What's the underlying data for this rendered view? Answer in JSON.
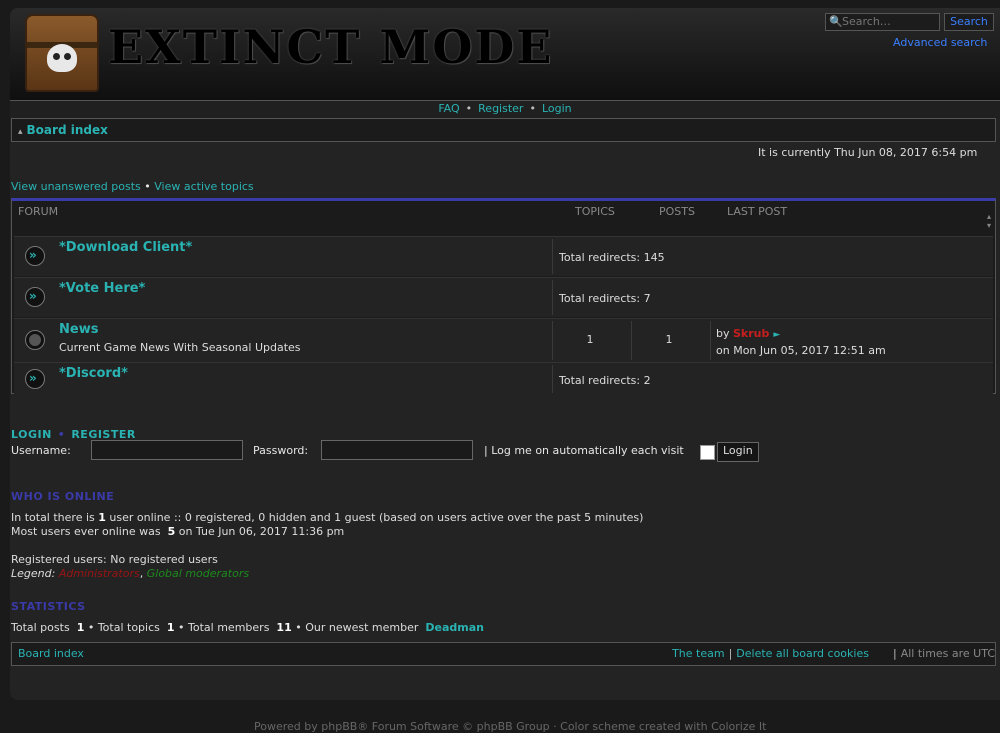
{
  "header": {
    "logo_text": "EXTINCT MODE",
    "search_placeholder": "Search…",
    "search_button": "Search",
    "advanced_search": "Advanced search"
  },
  "nav": {
    "faq": "FAQ",
    "register": "Register",
    "login": "Login"
  },
  "breadcrumb": {
    "board_index": "Board index"
  },
  "current_time": "It is currently Thu Jun 08, 2017 6:54 pm",
  "quick_links": {
    "unanswered": "View unanswered posts",
    "separator": "•",
    "active": "View active topics"
  },
  "forum_table": {
    "headers": {
      "forum": "FORUM",
      "topics": "TOPICS",
      "posts": "POSTS",
      "last_post": "LAST POST"
    },
    "rows": [
      {
        "title": "*Download Client*",
        "redirects": "Total redirects: 145"
      },
      {
        "title": "*Vote Here*",
        "redirects": "Total redirects: 7"
      },
      {
        "title": "News",
        "description": "Current Game News With Seasonal Updates",
        "topics": "1",
        "posts": "1",
        "last_post_by_label": "by",
        "last_post_user": "Skrub",
        "last_post_date": "on Mon Jun 05, 2017 12:51 am"
      },
      {
        "title": "*Discord*",
        "redirects": "Total redirects: 2"
      }
    ]
  },
  "login": {
    "title_login": "LOGIN",
    "title_register": "REGISTER",
    "username_label": "Username:",
    "password_label": "Password:",
    "remember_label": "| Log me on automatically each visit",
    "button": "Login"
  },
  "who_is_online": {
    "title": "WHO IS ONLINE",
    "line1_prefix": "In total there is",
    "line1_count": "1",
    "line1_suffix": "user online :: 0 registered, 0 hidden and 1 guest (based on users active over the past 5 minutes)",
    "line2_prefix": "Most users ever online was",
    "line2_count": "5",
    "line2_suffix": "on Tue Jun 06, 2017 11:36 pm",
    "registered": "Registered users: No registered users",
    "legend_label": "Legend:",
    "legend_admin": "Administrators",
    "legend_gmod": "Global moderators"
  },
  "statistics": {
    "title": "STATISTICS",
    "posts_label": "Total posts",
    "posts": "1",
    "topics_label": "• Total topics",
    "topics": "1",
    "members_label": "• Total members",
    "members": "11",
    "newest_label": "• Our newest member",
    "newest": "Deadman"
  },
  "footer": {
    "board_index": "Board index",
    "team": "The team",
    "delete_cookies": "Delete all board cookies",
    "times": "All times are UTC"
  },
  "powered": "Powered by phpBB® Forum Software © phpBB Group · Color scheme created with Colorize It"
}
